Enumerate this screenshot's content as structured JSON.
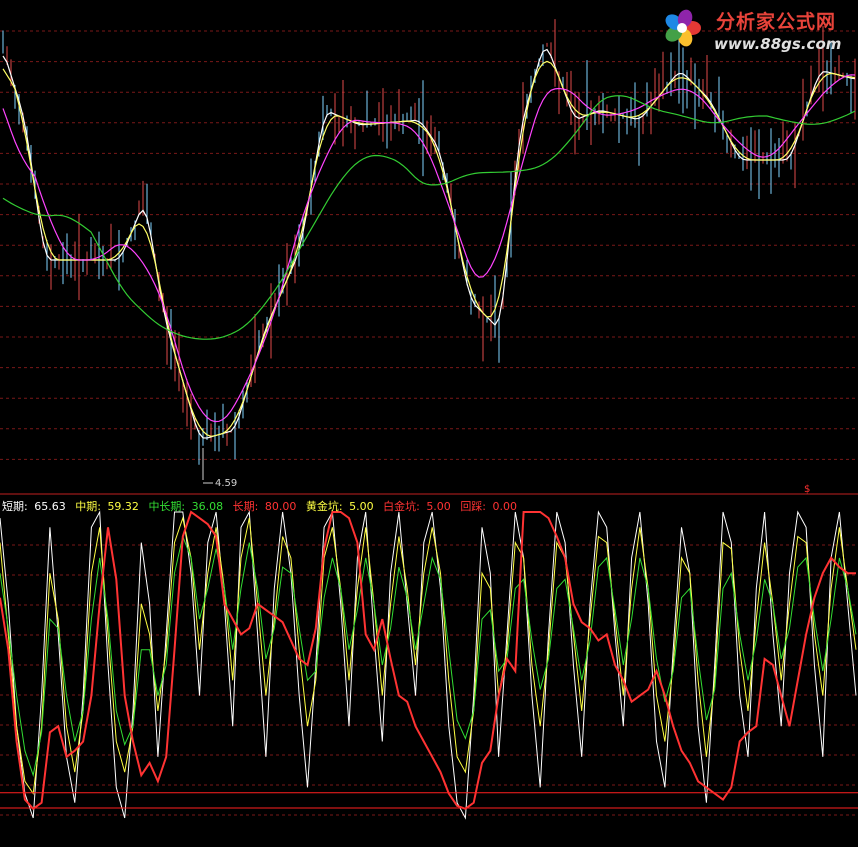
{
  "logo": {
    "title": "分析家公式网",
    "url": "www.88gs.com",
    "colors": [
      "#e53935",
      "#fbc02d",
      "#43a047",
      "#1e88e5",
      "#8e24aa"
    ]
  },
  "price_panel": {
    "low_label": "4.59",
    "lines": [
      {
        "role": "price-line-short",
        "color": "#ffffff"
      },
      {
        "role": "price-line-mid",
        "color": "#ffff66"
      },
      {
        "role": "price-line-long",
        "color": "#ff44ff"
      },
      {
        "role": "price-line-longer",
        "color": "#33cc33"
      }
    ]
  },
  "indicator_panel": {
    "legend": [
      {
        "label": "短期:",
        "value": "65.63",
        "color": "#ffffff"
      },
      {
        "label": "中期:",
        "value": "59.32",
        "color": "#ffff44"
      },
      {
        "label": "中长期:",
        "value": "36.08",
        "color": "#33dd33"
      },
      {
        "label": "长期:",
        "value": "80.00",
        "color": "#ff3333"
      },
      {
        "label": "黄金坑:",
        "value": "5.00",
        "color": "#ffff44"
      },
      {
        "label": "白金坑:",
        "value": "5.00",
        "color": "#ff3333"
      },
      {
        "label": "回踩:",
        "value": "0.00",
        "color": "#ff3333"
      }
    ],
    "marker": "$",
    "ylim": [
      0,
      100
    ],
    "thresholds": [
      5,
      0
    ]
  },
  "chart_data": {
    "type": "line",
    "series": [
      {
        "name": "短期",
        "color": "#ffffff",
        "values": [
          98,
          70,
          30,
          8,
          0,
          40,
          95,
          60,
          20,
          5,
          40,
          95,
          100,
          50,
          10,
          0,
          35,
          90,
          70,
          20,
          60,
          100,
          100,
          80,
          40,
          90,
          100,
          70,
          30,
          95,
          100,
          60,
          20,
          75,
          100,
          80,
          40,
          10,
          50,
          95,
          100,
          70,
          30,
          85,
          100,
          60,
          25,
          80,
          100,
          70,
          40,
          90,
          100,
          75,
          30,
          5,
          0,
          40,
          95,
          80,
          20,
          60,
          100,
          85,
          40,
          10,
          60,
          100,
          90,
          50,
          20,
          70,
          100,
          95,
          60,
          30,
          85,
          100,
          70,
          25,
          10,
          55,
          95,
          80,
          30,
          5,
          50,
          100,
          90,
          40,
          20,
          75,
          100,
          60,
          30,
          80,
          100,
          95,
          50,
          20,
          85,
          100,
          70,
          40
        ]
      },
      {
        "name": "中期",
        "color": "#ffff44",
        "values": [
          90,
          60,
          30,
          12,
          8,
          30,
          80,
          65,
          30,
          15,
          35,
          80,
          95,
          60,
          25,
          15,
          30,
          70,
          60,
          35,
          55,
          90,
          98,
          85,
          55,
          80,
          95,
          75,
          45,
          85,
          98,
          70,
          40,
          65,
          92,
          85,
          55,
          30,
          45,
          85,
          95,
          75,
          45,
          75,
          95,
          70,
          40,
          70,
          92,
          75,
          50,
          80,
          95,
          80,
          45,
          20,
          15,
          35,
          80,
          75,
          40,
          55,
          90,
          85,
          50,
          30,
          55,
          90,
          85,
          60,
          35,
          65,
          92,
          90,
          65,
          40,
          75,
          95,
          75,
          40,
          25,
          50,
          85,
          80,
          45,
          20,
          45,
          90,
          88,
          55,
          35,
          65,
          90,
          70,
          45,
          70,
          92,
          90,
          60,
          40,
          75,
          95,
          75,
          55
        ]
      },
      {
        "name": "中长期",
        "color": "#33dd33",
        "values": [
          80,
          62,
          40,
          22,
          14,
          28,
          65,
          62,
          40,
          25,
          35,
          65,
          85,
          65,
          35,
          24,
          30,
          55,
          55,
          40,
          50,
          80,
          92,
          85,
          65,
          75,
          88,
          75,
          55,
          75,
          90,
          75,
          52,
          62,
          82,
          80,
          62,
          45,
          48,
          72,
          85,
          75,
          55,
          68,
          85,
          70,
          50,
          62,
          82,
          72,
          55,
          70,
          85,
          78,
          55,
          32,
          26,
          35,
          65,
          68,
          48,
          52,
          75,
          78,
          58,
          42,
          52,
          75,
          78,
          62,
          45,
          58,
          82,
          85,
          68,
          50,
          65,
          85,
          75,
          52,
          38,
          48,
          72,
          75,
          52,
          32,
          42,
          75,
          80,
          60,
          45,
          58,
          78,
          70,
          52,
          62,
          82,
          85,
          65,
          48,
          65,
          85,
          75,
          60
        ]
      },
      {
        "name": "长期",
        "color": "#ff3333",
        "values": [
          72,
          55,
          25,
          6,
          3,
          5,
          28,
          30,
          20,
          22,
          25,
          40,
          70,
          95,
          78,
          40,
          25,
          14,
          18,
          12,
          20,
          55,
          92,
          100,
          98,
          96,
          92,
          70,
          65,
          60,
          62,
          70,
          68,
          66,
          64,
          58,
          52,
          50,
          62,
          88,
          100,
          100,
          98,
          90,
          60,
          55,
          65,
          52,
          40,
          38,
          30,
          25,
          20,
          15,
          8,
          4,
          3,
          5,
          18,
          22,
          40,
          52,
          48,
          100,
          100,
          100,
          98,
          92,
          85,
          70,
          64,
          62,
          58,
          60,
          50,
          45,
          38,
          40,
          42,
          48,
          40,
          30,
          22,
          18,
          12,
          10,
          8,
          6,
          10,
          25,
          28,
          30,
          52,
          50,
          40,
          30,
          45,
          60,
          72,
          80,
          85,
          82,
          80,
          80
        ]
      }
    ],
    "ylim": [
      0,
      100
    ]
  }
}
